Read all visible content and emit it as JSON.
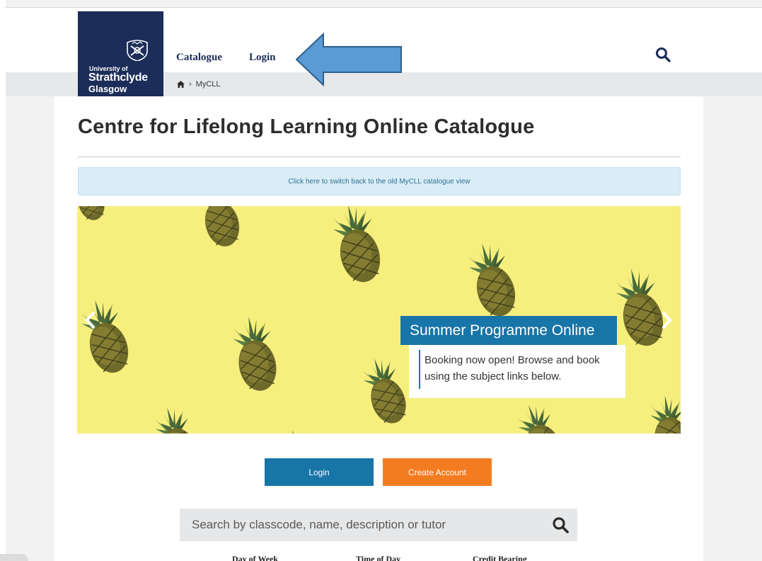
{
  "header": {
    "logo": {
      "line1": "University of",
      "line2": "Strathclyde",
      "line3": "Glasgow",
      "bg_color": "#1b2d58"
    },
    "nav": [
      {
        "label": "Catalogue"
      },
      {
        "label": "Login"
      }
    ],
    "search_icon": "search-icon",
    "annotation_arrow_color": "#5b9bd5"
  },
  "breadcrumb": {
    "home_icon": "home-icon",
    "separator": "›",
    "current": "MyCLL"
  },
  "main": {
    "title": "Centre for Lifelong Learning Online Catalogue",
    "alert_text": "Click here to switch back to the old MyCLL catalogue view",
    "carousel": {
      "caption_title": "Summer Programme Online",
      "caption_body": "Booking now open! Browse and book using the subject links below.",
      "prev_icon": "chevron-left-icon",
      "next_icon": "chevron-right-icon",
      "background_color": "#f6ef7e"
    },
    "buttons": {
      "login": "Login",
      "create_account": "Create Account",
      "login_color": "#1875a8",
      "create_color": "#f47c20"
    },
    "search": {
      "placeholder": "Search by classcode, name, description or tutor",
      "icon": "search-icon"
    },
    "filters": [
      {
        "label": "Day of Week"
      },
      {
        "label": "Time of Day"
      },
      {
        "label": "Credit Bearing"
      }
    ]
  }
}
